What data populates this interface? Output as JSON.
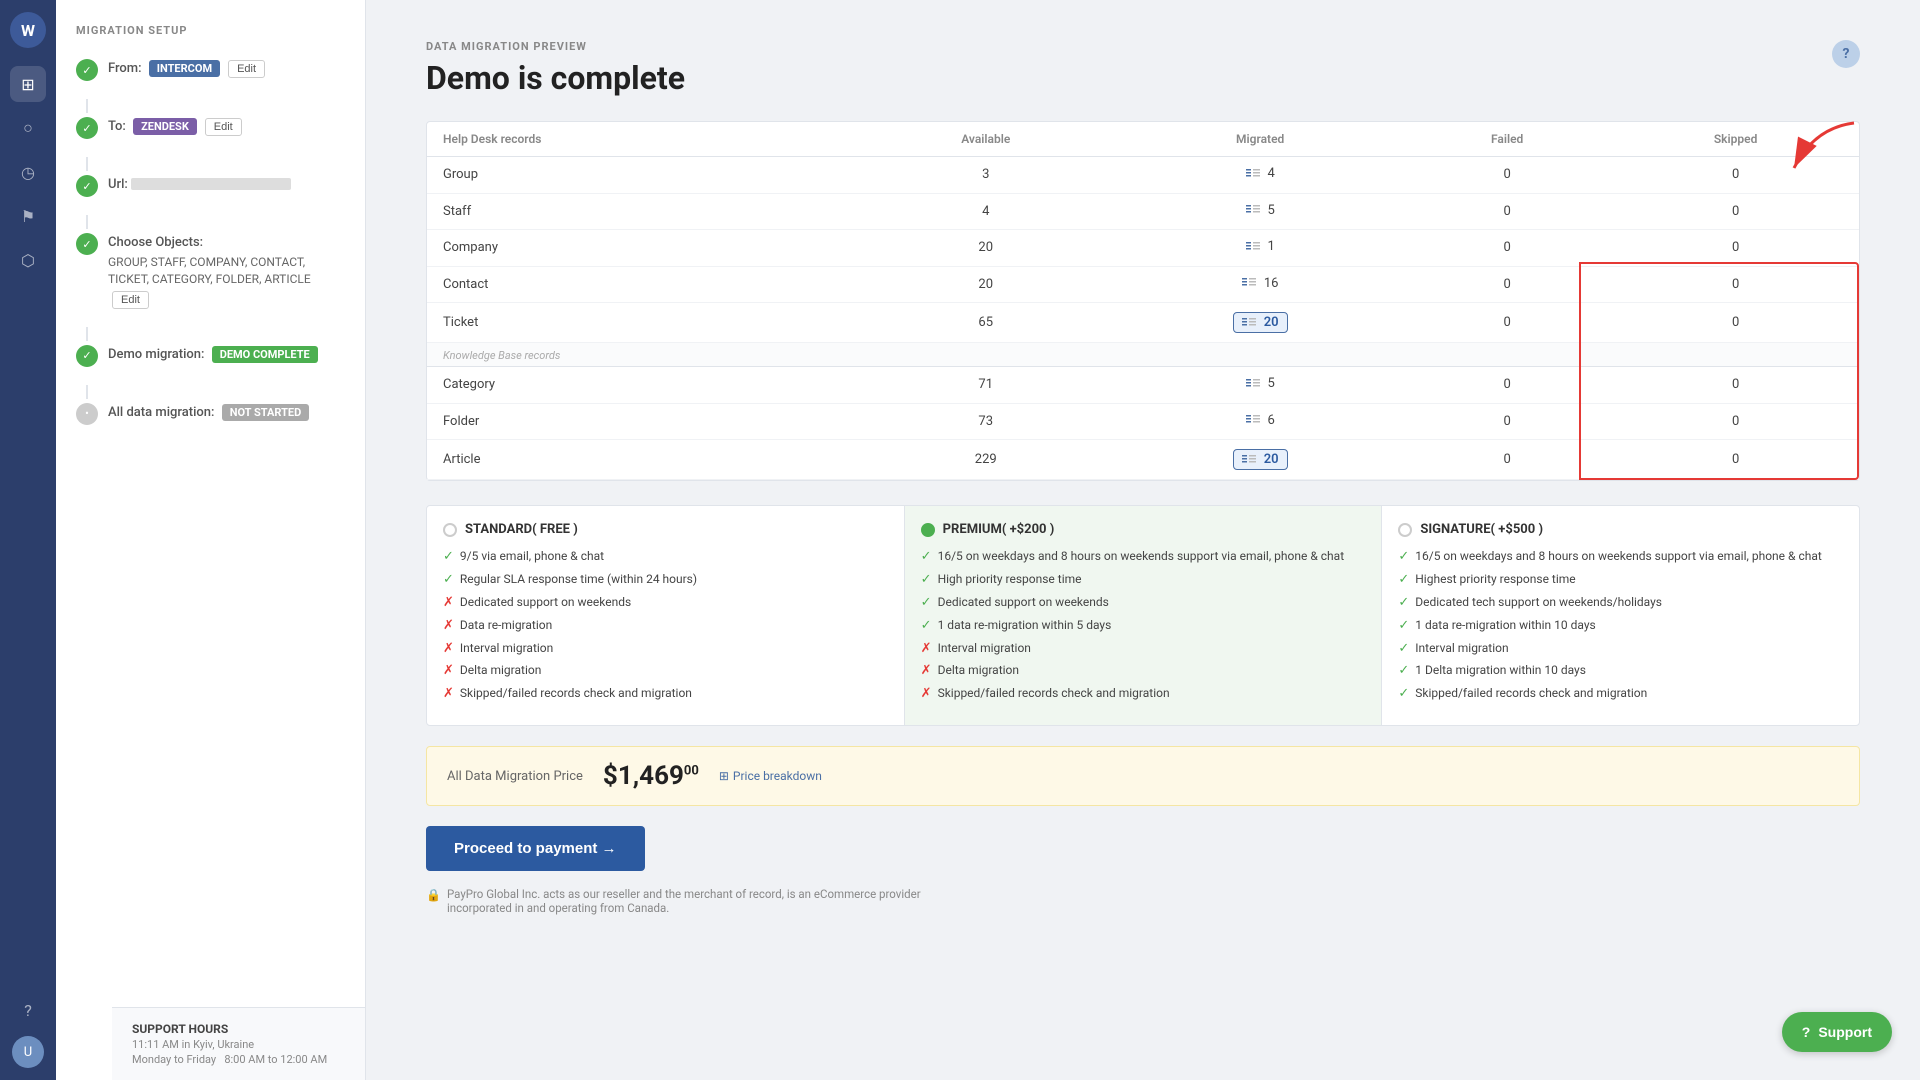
{
  "sidebar": {
    "logo_text": "W",
    "nav_items": [
      {
        "icon": "⊞",
        "name": "grid-icon",
        "active": true
      },
      {
        "icon": "○",
        "name": "circle-icon",
        "active": false
      },
      {
        "icon": "◷",
        "name": "clock-icon",
        "active": false
      },
      {
        "icon": "⚑",
        "name": "flag-icon",
        "active": false
      },
      {
        "icon": "⬡",
        "name": "hex-icon",
        "active": false
      }
    ],
    "bottom": [
      {
        "icon": "?",
        "name": "help-icon"
      },
      {
        "icon": "U",
        "name": "user-avatar"
      }
    ]
  },
  "left_panel": {
    "section_title": "MIGRATION SETUP",
    "steps": [
      {
        "id": "from",
        "label": "From:",
        "badge": "INTERCOM",
        "badge_class": "badge-blue",
        "edit": true,
        "edit_label": "Edit"
      },
      {
        "id": "to",
        "label": "To:",
        "badge": "ZENDESK",
        "badge_class": "badge-purple",
        "edit": true,
        "edit_label": "Edit"
      },
      {
        "id": "url",
        "label": "Url:",
        "has_url": true
      },
      {
        "id": "objects",
        "label": "Choose Objects:",
        "objects_text": "GROUP, STAFF, COMPANY, CONTACT, TICKET, CATEGORY, FOLDER, ARTICLE",
        "edit": true,
        "edit_label": "Edit"
      },
      {
        "id": "demo",
        "label": "Demo migration:",
        "badge": "DEMO COMPLETE",
        "badge_class": "badge-green"
      },
      {
        "id": "alldata",
        "label": "All data migration:",
        "badge": "NOT STARTED",
        "badge_class": "badge-gray"
      }
    ],
    "support": {
      "title": "SUPPORT HOURS",
      "hours": "Monday to Friday",
      "time": "8:00 AM to 12:00 AM",
      "local_time": "11:11 AM in Kyiv, Ukraine"
    }
  },
  "main": {
    "preview_label": "DATA MIGRATION PREVIEW",
    "page_title": "Demo is complete",
    "table": {
      "columns": [
        "Help Desk records",
        "Available",
        "Migrated",
        "Failed",
        "Skipped"
      ],
      "helpdesk_rows": [
        {
          "name": "Group",
          "available": 3,
          "migrated": 4,
          "failed": 0,
          "skipped": 0,
          "highlighted": false
        },
        {
          "name": "Staff",
          "available": 4,
          "migrated": 5,
          "failed": 0,
          "skipped": 0,
          "highlighted": false
        },
        {
          "name": "Company",
          "available": 20,
          "migrated": 1,
          "failed": 0,
          "skipped": 0,
          "highlighted": false
        },
        {
          "name": "Contact",
          "available": 20,
          "migrated": 16,
          "failed": 0,
          "skipped": 0,
          "highlighted": false
        },
        {
          "name": "Ticket",
          "available": 65,
          "migrated": 20,
          "failed": 0,
          "skipped": 0,
          "highlighted": true
        }
      ],
      "kb_section_label": "Knowledge Base records",
      "kb_rows": [
        {
          "name": "Category",
          "available": 71,
          "migrated": 5,
          "failed": 0,
          "skipped": 0,
          "highlighted": false
        },
        {
          "name": "Folder",
          "available": 73,
          "migrated": 6,
          "failed": 0,
          "skipped": 0,
          "highlighted": false
        },
        {
          "name": "Article",
          "available": 229,
          "migrated": 20,
          "failed": 0,
          "skipped": 0,
          "highlighted": true
        }
      ]
    },
    "plans": [
      {
        "id": "standard",
        "title": "STANDARD( FREE )",
        "selected": false,
        "features": [
          {
            "text": "9/5 via email, phone & chat",
            "check": true
          },
          {
            "text": "Regular SLA response time (within 24 hours)",
            "check": true
          },
          {
            "text": "Dedicated support on weekends",
            "check": false
          },
          {
            "text": "Data re-migration",
            "check": false
          },
          {
            "text": "Interval migration",
            "check": false
          },
          {
            "text": "Delta migration",
            "check": false
          },
          {
            "text": "Skipped/failed records check and migration",
            "check": false
          }
        ]
      },
      {
        "id": "premium",
        "title": "PREMIUM( +$200 )",
        "selected": true,
        "features": [
          {
            "text": "16/5 on weekdays and 8 hours on weekends support via email, phone & chat",
            "check": true
          },
          {
            "text": "High priority response time",
            "check": true
          },
          {
            "text": "Dedicated support on weekends",
            "check": true
          },
          {
            "text": "1 data re-migration within 5 days",
            "check": true
          },
          {
            "text": "Interval migration",
            "check": false
          },
          {
            "text": "Delta migration",
            "check": false
          },
          {
            "text": "Skipped/failed records check and migration",
            "check": false
          }
        ]
      },
      {
        "id": "signature",
        "title": "SIGNATURE( +$500 )",
        "selected": false,
        "features": [
          {
            "text": "16/5 on weekdays and 8 hours on weekends support via email, phone & chat",
            "check": true
          },
          {
            "text": "Highest priority response time",
            "check": true
          },
          {
            "text": "Dedicated tech support on weekends/holidays",
            "check": true
          },
          {
            "text": "1 data re-migration within 10 days",
            "check": true
          },
          {
            "text": "Interval migration",
            "check": true
          },
          {
            "text": "1 Delta migration within 10 days",
            "check": true
          },
          {
            "text": "Skipped/failed records check and migration",
            "check": true
          }
        ]
      }
    ],
    "price": {
      "label": "All Data Migration Price",
      "amount": "$1,469",
      "cents": "00",
      "breakdown_label": "Price breakdown"
    },
    "proceed_button": "Proceed to payment →",
    "paypro_note": "PayPro Global Inc. acts as our reseller and the merchant of record, is an eCommerce provider incorporated in and operating from Canada."
  },
  "support_button": {
    "label": "Support",
    "icon": "?"
  }
}
